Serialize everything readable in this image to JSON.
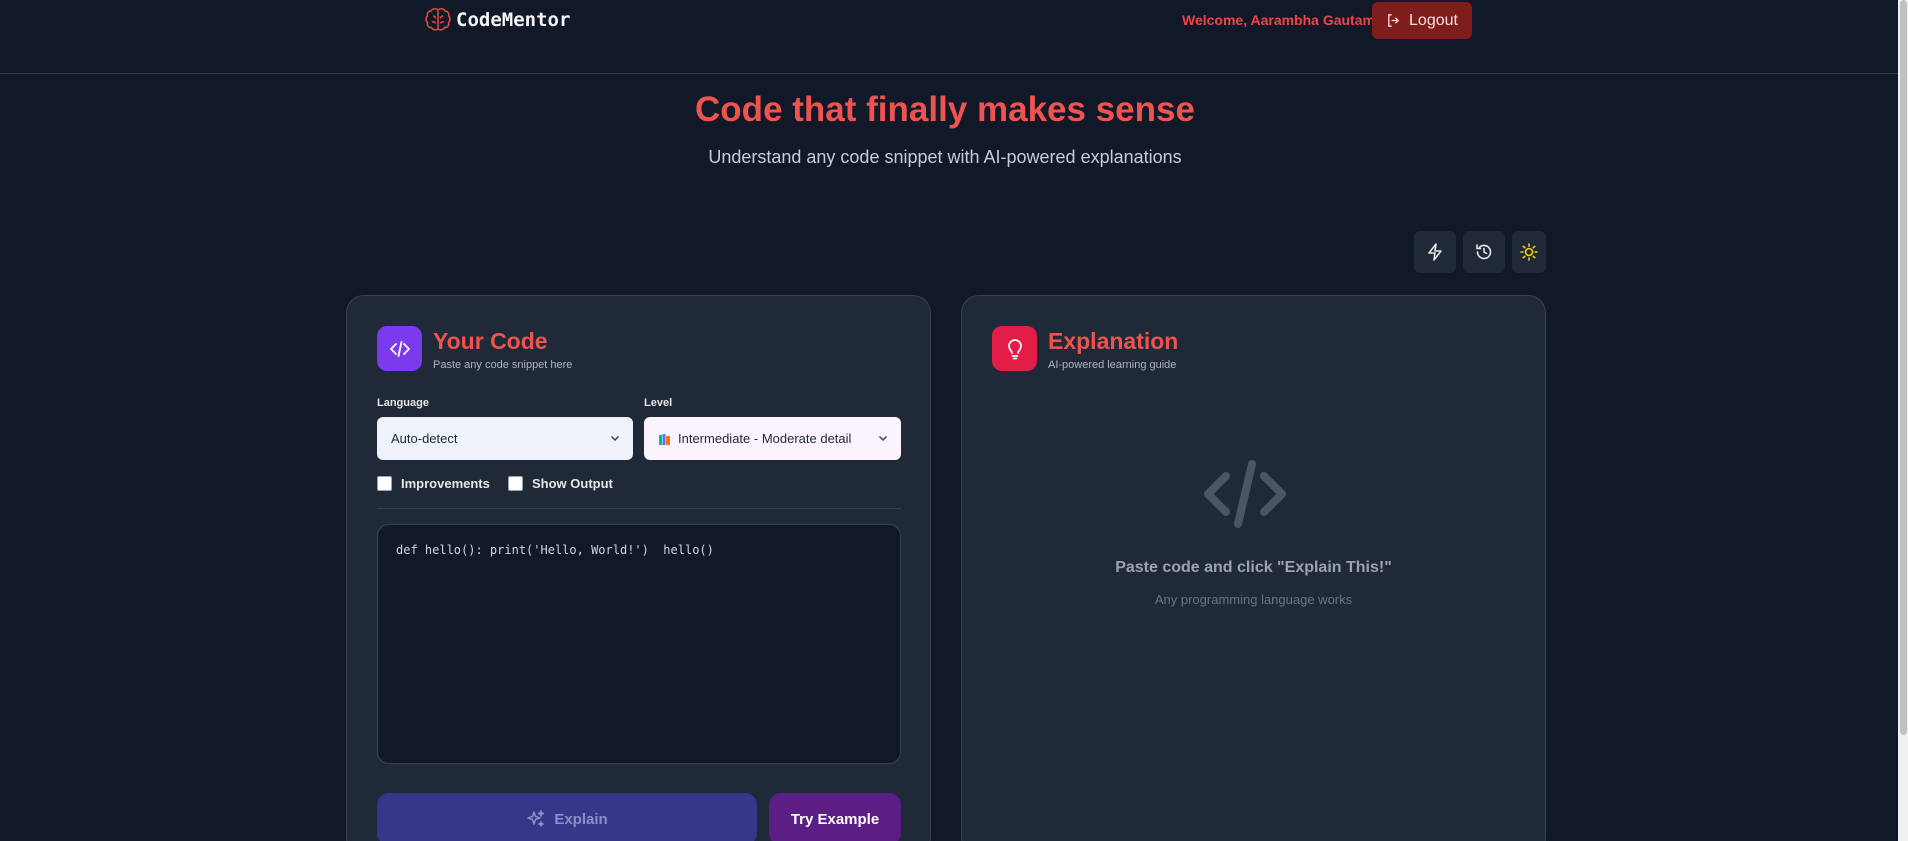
{
  "header": {
    "brand": "CodeMentor",
    "welcome": "Welcome, Aarambha Gautam",
    "logout_label": "Logout",
    "icons": {
      "brand": "brain-icon",
      "logout": "logout-icon"
    }
  },
  "hero": {
    "title": "Code that finally makes sense",
    "subtitle": "Understand any code snippet with AI-powered explanations"
  },
  "toolbar": {
    "icons": [
      "lightning-icon",
      "history-icon",
      "sun-icon"
    ]
  },
  "code_panel": {
    "title": "Your Code",
    "subtitle": "Paste any code snippet here",
    "language_label": "Language",
    "language_value": "Auto-detect",
    "level_label": "Level",
    "level_value": "Intermediate - Moderate detail",
    "checkbox_improvements": "Improvements",
    "checkbox_output": "Show Output",
    "code": "def hello(): print('Hello, World!')  hello()",
    "explain_label": "Explain",
    "example_label": "Try Example"
  },
  "explanation_panel": {
    "title": "Explanation",
    "subtitle": "AI-powered learning guide",
    "empty_title": "Paste code and click \"Explain This!\"",
    "empty_subtitle": "Any programming language works"
  },
  "colors": {
    "background": "#111827",
    "card": "#1f2937",
    "accent_red": "#ef5350",
    "logout_bg": "#7f1d1d",
    "code_icon_bg": "#7c3aed",
    "bulb_icon_bg": "#e11d48",
    "explain_bg": "#373689",
    "example_bg": "#5b1e85"
  }
}
